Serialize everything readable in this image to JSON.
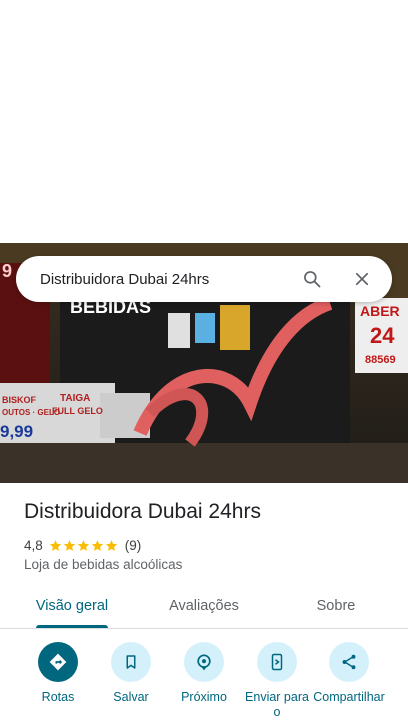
{
  "search": {
    "query": "Distribuidora Dubai 24hrs"
  },
  "place": {
    "name": "Distribuidora Dubai 24hrs",
    "rating": "4,8",
    "stars": 5,
    "review_count": "(9)",
    "category": "Loja de bebidas alcoólicas"
  },
  "photo_signage": {
    "bebidas": "BEBIDAS",
    "aberto": "ABER",
    "hours": "24",
    "phone": "88569",
    "banner1": "BISKOF",
    "banner1_line2": "OUTOS · GELO",
    "banner1_price": "9,99",
    "banner2": "TAIGA",
    "banner2_line2": "FULL GELO",
    "side_digit": "9"
  },
  "tabs": [
    {
      "label": "Visão geral",
      "active": true
    },
    {
      "label": "Avaliações",
      "active": false
    },
    {
      "label": "Sobre",
      "active": false
    }
  ],
  "actions": [
    {
      "label": "Rotas",
      "icon": "directions-icon"
    },
    {
      "label": "Salvar",
      "icon": "bookmark-icon"
    },
    {
      "label": "Próximo",
      "icon": "nearby-icon"
    },
    {
      "label": "Enviar para o",
      "icon": "send-to-phone-icon"
    },
    {
      "label": "Compartilhar",
      "icon": "share-icon"
    }
  ],
  "colors": {
    "accent": "#00677f",
    "accent_light": "#d4f1fb",
    "star": "#fbbc04"
  }
}
